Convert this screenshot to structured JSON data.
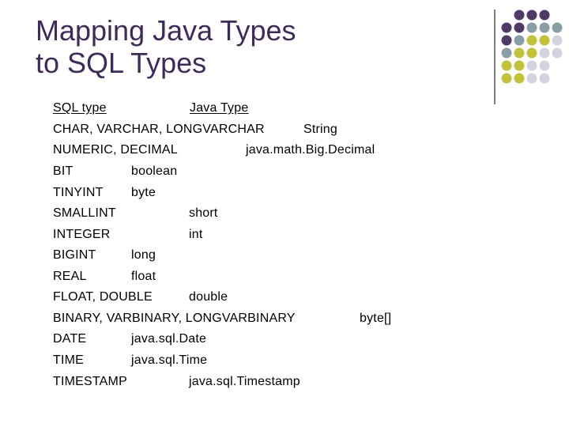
{
  "slide": {
    "title_line1": "Mapping Java Types",
    "title_line2": "to SQL Types"
  },
  "table": {
    "header": {
      "sql": "SQL type ",
      "java": "Java Type "
    },
    "rows": [
      {
        "sql": "CHAR, VARCHAR, LONGVARCHAR",
        "java": "String"
      },
      {
        "sql": "NUMERIC, DECIMAL",
        "java": "java.math.Big.Decimal"
      },
      {
        "sql": "BIT",
        "java": "boolean"
      },
      {
        "sql": "TINYINT",
        "java": "byte"
      },
      {
        "sql": "SMALLINT",
        "java": "short"
      },
      {
        "sql": "INTEGER",
        "java": "int"
      },
      {
        "sql": "BIGINT",
        "java": "long"
      },
      {
        "sql": "REAL",
        "java": "float"
      },
      {
        "sql": "FLOAT, DOUBLE",
        "java": "double"
      },
      {
        "sql": "BINARY, VARBINARY, LONGVARBINARY",
        "java": "byte[]"
      },
      {
        "sql": "DATE",
        "java": "java.sql.Date"
      },
      {
        "sql": "TIME",
        "java": "java.sql.Time"
      },
      {
        "sql": "TIMESTAMP",
        "java": "java.sql.Timestamp"
      }
    ]
  },
  "decoration": {
    "dot_colors": {
      "purple": "#4f3a68",
      "teal": "#87a0a6",
      "olive": "#c2c238",
      "light": "#d4d4e0"
    },
    "divider_color": "#555555"
  }
}
